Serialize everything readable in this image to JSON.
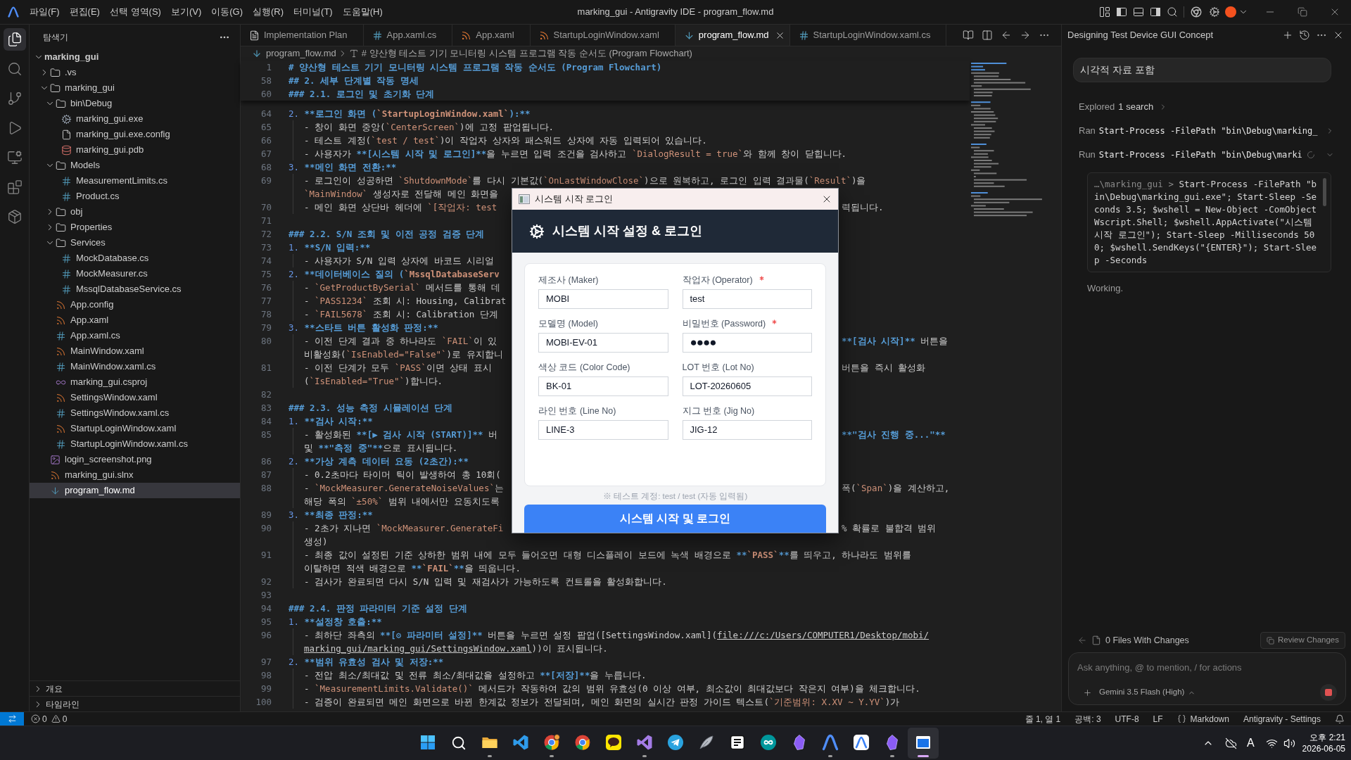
{
  "title_bar": {
    "menus": [
      "파일(F)",
      "편집(E)",
      "선택 영역(S)",
      "보기(V)",
      "이동(G)",
      "실행(R)",
      "터미널(T)",
      "도움말(H)"
    ],
    "title": "marking_gui - Antigravity IDE - program_flow.md",
    "layout_toggles": [
      {
        "kind": "customize"
      },
      {
        "kind": "primary",
        "on": true
      },
      {
        "kind": "panel",
        "on": false
      },
      {
        "kind": "secondary",
        "on": true
      }
    ]
  },
  "activity_bar": [
    {
      "kind": "explorer",
      "selected": true
    },
    {
      "kind": "search",
      "selected": false
    },
    {
      "kind": "git",
      "selected": false
    },
    {
      "kind": "debug",
      "selected": false
    },
    {
      "kind": "remote",
      "selected": false
    },
    {
      "kind": "extensions",
      "selected": false
    },
    {
      "kind": "packages",
      "selected": false
    }
  ],
  "sidebar": {
    "title": "탐색기",
    "tree": [
      {
        "label": "marking_gui",
        "kind": "root",
        "expanded": true,
        "selected": false,
        "children": [
          {
            "label": ".vs",
            "kind": "folder",
            "expanded": false,
            "selected": false
          },
          {
            "label": "marking_gui",
            "kind": "folder",
            "expanded": true,
            "selected": false,
            "children": [
              {
                "label": "bin\\Debug",
                "kind": "folder",
                "expanded": true,
                "selected": false,
                "children": [
                  {
                    "label": "marking_gui.exe",
                    "kind": "exe",
                    "selected": false
                  },
                  {
                    "label": "marking_gui.exe.config",
                    "kind": "config",
                    "selected": false
                  },
                  {
                    "label": "marking_gui.pdb",
                    "kind": "pdb",
                    "selected": false
                  }
                ]
              },
              {
                "label": "Models",
                "kind": "folder",
                "expanded": true,
                "selected": false,
                "children": [
                  {
                    "label": "MeasurementLimits.cs",
                    "kind": "cs",
                    "selected": false
                  },
                  {
                    "label": "Product.cs",
                    "kind": "cs",
                    "selected": false
                  }
                ]
              },
              {
                "label": "obj",
                "kind": "folder",
                "expanded": false,
                "selected": false
              },
              {
                "label": "Properties",
                "kind": "folder",
                "expanded": false,
                "selected": false
              },
              {
                "label": "Services",
                "kind": "folder",
                "expanded": true,
                "selected": false,
                "children": [
                  {
                    "label": "MockDatabase.cs",
                    "kind": "cs",
                    "selected": false
                  },
                  {
                    "label": "MockMeasurer.cs",
                    "kind": "cs",
                    "selected": false
                  },
                  {
                    "label": "MssqlDatabaseService.cs",
                    "kind": "cs",
                    "selected": false
                  }
                ]
              },
              {
                "label": "App.config",
                "kind": "xml",
                "selected": false
              },
              {
                "label": "App.xaml",
                "kind": "xml",
                "selected": false
              },
              {
                "label": "App.xaml.cs",
                "kind": "cs",
                "selected": false
              },
              {
                "label": "MainWindow.xaml",
                "kind": "xml",
                "selected": false
              },
              {
                "label": "MainWindow.xaml.cs",
                "kind": "cs",
                "selected": false
              },
              {
                "label": "marking_gui.csproj",
                "kind": "csproj",
                "selected": false
              },
              {
                "label": "SettingsWindow.xaml",
                "kind": "xml",
                "selected": false
              },
              {
                "label": "SettingsWindow.xaml.cs",
                "kind": "cs",
                "selected": false
              },
              {
                "label": "StartupLoginWindow.xaml",
                "kind": "xml",
                "selected": false
              },
              {
                "label": "StartupLoginWindow.xaml.cs",
                "kind": "cs",
                "selected": false
              }
            ]
          },
          {
            "label": "login_screenshot.png",
            "kind": "image",
            "selected": false
          },
          {
            "label": "marking_gui.slnx",
            "kind": "xml",
            "selected": false
          },
          {
            "label": "program_flow.md",
            "kind": "md",
            "selected": true
          }
        ]
      }
    ],
    "sections": [
      {
        "label": "개요",
        "expanded": false
      },
      {
        "label": "타임라인",
        "expanded": false
      }
    ]
  },
  "editor": {
    "tabs": [
      {
        "label": "Implementation Plan",
        "kind": "plan",
        "selected": false
      },
      {
        "label": "App.xaml.cs",
        "kind": "cs",
        "selected": false
      },
      {
        "label": "App.xaml",
        "kind": "xaml",
        "selected": false
      },
      {
        "label": "StartupLoginWindow.xaml",
        "kind": "xaml",
        "selected": false
      },
      {
        "label": "program_flow.md",
        "kind": "md",
        "selected": true
      },
      {
        "label": "StartupLoginWindow.xaml.cs",
        "kind": "cs",
        "selected": false
      }
    ],
    "breadcrumb": {
      "file": "program_flow.md",
      "symbol": "# 양산형 테스트 기기 모니터링 시스템 프로그램 작동 순서도 (Program Flowchart)"
    },
    "sticky_lines": [
      {
        "number": "1",
        "rows": [
          {
            "text": "# 양산형 테스트 기기 모니터링 시스템 프로그램 작동 순서도 (Program Flowchart)"
          }
        ]
      },
      {
        "number": "58",
        "rows": [
          {
            "text": "## 2. 세부 단계별 작동 명세"
          }
        ]
      },
      {
        "number": "60",
        "rows": [
          {
            "text": "### 2.1. 로그인 및 초기화 단계"
          }
        ]
      }
    ],
    "lines": [
      {
        "number": "64",
        "rows": [
          {
            "text": "2. **로그인 화면 (`StartupLoginWindow.xaml`):**"
          }
        ],
        "children": [
          {
            "number": "65",
            "rows": [
              {
                "text": "- 창이 화면 중앙(`CenterScreen`)에 고정 팝업됩니다."
              }
            ]
          },
          {
            "number": "66",
            "rows": [
              {
                "text": "- 테스트 계정(`test / test`)이 작업자 상자와 패스워드 상자에 자동 입력되어 있습니다."
              }
            ]
          },
          {
            "number": "67",
            "rows": [
              {
                "text": "- 사용자가 **[시스템 시작 및 로그인]**을 누르면 입력 조건을 검사하고 `DialogResult = true`와 함께 창이 닫힙니다."
              }
            ]
          }
        ]
      },
      {
        "number": "68",
        "rows": [
          {
            "text": "3. **메인 화면 전환:**"
          }
        ],
        "children": [
          {
            "number": "69",
            "rows": [
              {
                "text": "- 로그인이 성공하면 `ShutdownMode`를 다시 기본값(`OnLastWindowClose`)으로 원복하고, 로그인 입력 결과물(`Result`)을"
              },
              {
                "text": "`MainWindow` 생성자로 전달해 메인 화면을"
              }
            ]
          },
          {
            "number": "70",
            "rows": [
              {
                "text": "- 메인 화면 상단바 헤더에 `[작업자: test",
                "text_right": "력됩니다."
              }
            ]
          }
        ]
      },
      {
        "number": "71"
      },
      {
        "number": "72",
        "rows": [
          {
            "text": "### 2.2. S/N 조회 및 이전 공정 검증 단계"
          }
        ]
      },
      {
        "number": "73",
        "rows": [
          {
            "text": "1. **S/N 입력:**"
          }
        ],
        "children": [
          {
            "number": "74",
            "rows": [
              {
                "text": "- 사용자가 S/N 입력 상자에 바코드 시리얼"
              }
            ]
          }
        ]
      },
      {
        "number": "75",
        "rows": [
          {
            "text": "2. **데이터베이스 질의 (`MssqlDatabaseServ"
          }
        ],
        "children": [
          {
            "number": "76",
            "rows": [
              {
                "text": "- `GetProductBySerial` 메서드를 통해 데"
              }
            ]
          },
          {
            "number": "77",
            "rows": [
              {
                "text": "- `PASS1234` 조회 시: Housing, Calibrat"
              }
            ]
          },
          {
            "number": "78",
            "rows": [
              {
                "text": "- `FAIL5678` 조회 시: Calibration 단계"
              }
            ]
          }
        ]
      },
      {
        "number": "79",
        "rows": [
          {
            "text": "3. **스타트 버튼 활성화 판정:**"
          }
        ],
        "children": [
          {
            "number": "80",
            "rows": [
              {
                "text": "- 이전 단계 결과 중 하나라도 `FAIL`이 있",
                "text_right": "**[검사 시작]** 버튼을"
              },
              {
                "text": "비활성화(`IsEnabled=\"False\"`)로 유지합니"
              }
            ]
          },
          {
            "number": "81",
            "rows": [
              {
                "text": "- 이전 단계가 모두 `PASS`이면 상태 표시",
                "text_right": "버튼을 즉시 활성화"
              },
              {
                "text": "(`IsEnabled=\"True\"`)합니다."
              }
            ]
          }
        ]
      },
      {
        "number": "82"
      },
      {
        "number": "83",
        "rows": [
          {
            "text": "### 2.3. 성능 측정 시뮬레이션 단계"
          }
        ]
      },
      {
        "number": "84",
        "rows": [
          {
            "text": "1. **검사 시작:**"
          }
        ],
        "children": [
          {
            "number": "85",
            "rows": [
              {
                "text": "- 활성화된 **[▶ 검사 시작 (START)]** 버",
                "text_right": "**\"검사 진행 중...\"**"
              },
              {
                "text": "및 **\"측정 중\"**으로 표시됩니다."
              }
            ]
          }
        ]
      },
      {
        "number": "86",
        "rows": [
          {
            "text": "2. **가상 계측 데이터 요동 (2초간):**"
          }
        ],
        "children": [
          {
            "number": "87",
            "rows": [
              {
                "text": "- 0.2초마다 타이머 틱이 발생하여 총 10회("
              }
            ]
          },
          {
            "number": "88",
            "rows": [
              {
                "text": "- `MockMeasurer.GenerateNoiseValues`는",
                "text_right": "폭(`Span`)을 계산하고,"
              },
              {
                "text": "해당 폭의 `±50%` 범위 내에서만 요동치도록"
              }
            ]
          }
        ]
      },
      {
        "number": "89",
        "rows": [
          {
            "text": "3. **최종 판정:**"
          }
        ],
        "children": [
          {
            "number": "90",
            "rows": [
              {
                "text": "- 2초가 지나면 `MockMeasurer.GenerateFi",
                "text_right": "% 확률로 불합격 범위"
              },
              {
                "text": "생성)"
              }
            ]
          },
          {
            "number": "91",
            "rows": [
              {
                "text": "- 최종 값이 설정된 기준 상하한 범위 내에 모두 들어오면 대형 디스플레이 보드에 녹색 배경으로 **`PASS`**를 띄우고, 하나라도 범위를"
              },
              {
                "text": "이탈하면 적색 배경으로 **`FAIL`**을 띄웁니다."
              }
            ]
          },
          {
            "number": "92",
            "rows": [
              {
                "text": "- 검사가 완료되면 다시 S/N 입력 및 재검사가 가능하도록 컨트롤을 활성화합니다."
              }
            ]
          }
        ]
      },
      {
        "number": "93"
      },
      {
        "number": "94",
        "rows": [
          {
            "text": "### 2.4. 판정 파라미터 기준 설정 단계"
          }
        ]
      },
      {
        "number": "95",
        "rows": [
          {
            "text": "1. **설정창 호출:**"
          }
        ],
        "children": [
          {
            "number": "96",
            "rows": [
              {
                "text": "- 최하단 좌측의 **[⚙ 파라미터 설정]** 버튼을 누르면 설정 팝업([SettingsWindow.xaml](",
                "link": "file:///c:/Users/COMPUTER1/Desktop/mobi/"
              },
              {
                "link": "marking_gui/marking_gui/SettingsWindow.xaml",
                "tail": "))이 표시됩니다."
              }
            ]
          }
        ]
      },
      {
        "number": "97",
        "rows": [
          {
            "text": "2. **범위 유효성 검사 및 저장:**"
          }
        ],
        "children": [
          {
            "number": "98",
            "rows": [
              {
                "text": "- 전압 최소/최대값 및 전류 최소/최대값을 설정하고 **[저장]**을 누릅니다."
              }
            ]
          },
          {
            "number": "99",
            "rows": [
              {
                "text": "- `MeasurementLimits.Validate()` 메서드가 작동하여 값의 범위 유효성(0 이상 여부, 최소값이 최대값보다 작은지 여부)을 체크합니다."
              }
            ]
          },
          {
            "number": "100",
            "rows": [
              {
                "text": "- 검증이 완료되면 메인 화면으로 바뀐 한계값 정보가 전달되며, 메인 화면의 실시간 판정 가이드 텍스트(`기준범위: X.XV ~ Y.YV`)가"
              }
            ]
          }
        ]
      }
    ]
  },
  "agent_panel": {
    "title": "Designing Test Device GUI Concept",
    "user_message": "시각적 자료 포함",
    "steps": [
      {
        "kind": "explored",
        "label": "Explored",
        "detail": "1 search",
        "expanded": false
      },
      {
        "kind": "ran",
        "label": "Ran",
        "command": "Start-Process -FilePath \"bin\\Debug\\marking_",
        "expanded": false
      },
      {
        "kind": "running",
        "label": "Run",
        "command": "Start-Process -FilePath \"bin\\Debug\\marki",
        "expanded": true
      }
    ],
    "terminal": {
      "prompt": "…\\marking_gui",
      "separator": ">",
      "command": "Start-Process -FilePath \"bin\\Debug\\marking_gui.exe\"; Start-Sleep -Seconds 3.5; $wshell = New-Object -ComObject Wscript.Shell; $wshell.AppActivate(\"시스템 시작 로그인\"); Start-Sleep -Milliseconds 500; $wshell.SendKeys(\"{ENTER}\"); Start-Sleep -Seconds"
    },
    "status": "Working.",
    "changes": {
      "label": "0 Files With Changes",
      "review_button": "Review Changes"
    },
    "composer": {
      "placeholder": "Ask anything, @ to mention, / for actions",
      "model": "Gemini 3.5 Flash (High)"
    }
  },
  "login_dialog": {
    "title": "시스템 시작 로그인",
    "header": "시스템 시작 설정 & 로그인",
    "fields": [
      {
        "label": "제조사 (Maker)",
        "value": "MOBI",
        "required": false,
        "kind": "text"
      },
      {
        "label": "작업자 (Operator)",
        "value": "test",
        "required": true,
        "kind": "text"
      },
      {
        "label": "모델명 (Model)",
        "value": "MOBI-EV-01",
        "required": false,
        "kind": "text"
      },
      {
        "label": "비밀번호 (Password)",
        "value": "●●●●",
        "required": true,
        "kind": "password"
      },
      {
        "label": "색상 코드 (Color Code)",
        "value": "BK-01",
        "required": false,
        "kind": "text"
      },
      {
        "label": "LOT 번호 (Lot No)",
        "value": "LOT-20260605",
        "required": false,
        "kind": "text"
      },
      {
        "label": "라인 번호 (Line No)",
        "value": "LINE-3",
        "required": false,
        "kind": "text"
      },
      {
        "label": "지그 번호 (Jig No)",
        "value": "JIG-12",
        "required": false,
        "kind": "text"
      }
    ],
    "note": "※ 테스트 계정: test / test (자동 입력됨)",
    "submit_button": "시스템 시작 및 로그인"
  },
  "status_bar": {
    "problems": {
      "errors": "0",
      "warnings": "0"
    },
    "items": [
      {
        "kind": "text",
        "label": "줄 1, 열 1"
      },
      {
        "kind": "text",
        "label": "공백: 3"
      },
      {
        "kind": "text",
        "label": "UTF-8"
      },
      {
        "kind": "text",
        "label": "LF"
      },
      {
        "kind": "language",
        "label": "Markdown"
      },
      {
        "kind": "text",
        "label": "Antigravity - Settings"
      }
    ]
  },
  "taskbar": {
    "apps": [
      {
        "kind": "start",
        "running": false,
        "selected": false
      },
      {
        "kind": "search",
        "running": false,
        "selected": false
      },
      {
        "kind": "files",
        "running": true,
        "selected": false
      },
      {
        "kind": "code",
        "running": false,
        "selected": false
      },
      {
        "kind": "browser",
        "badge": true,
        "running": true,
        "selected": false
      },
      {
        "kind": "browser",
        "badge": false,
        "running": false,
        "selected": false
      },
      {
        "kind": "chat",
        "running": false,
        "selected": false
      },
      {
        "kind": "studio",
        "running": true,
        "selected": false
      },
      {
        "kind": "telegram",
        "running": false,
        "selected": false
      },
      {
        "kind": "feather",
        "running": false,
        "selected": false
      },
      {
        "kind": "notes",
        "running": false,
        "selected": false
      },
      {
        "kind": "arduino",
        "running": false,
        "selected": false
      },
      {
        "kind": "gem",
        "running": false,
        "selected": false
      },
      {
        "kind": "arch",
        "running": true,
        "selected": false
      },
      {
        "kind": "archtile",
        "running": false,
        "selected": false
      },
      {
        "kind": "gem",
        "running": true,
        "selected": false
      },
      {
        "kind": "window",
        "running": true,
        "selected": true
      }
    ],
    "tray": {
      "ime": "A"
    },
    "clock": {
      "time": "오후 2:21",
      "date": "2026-06-05"
    }
  }
}
